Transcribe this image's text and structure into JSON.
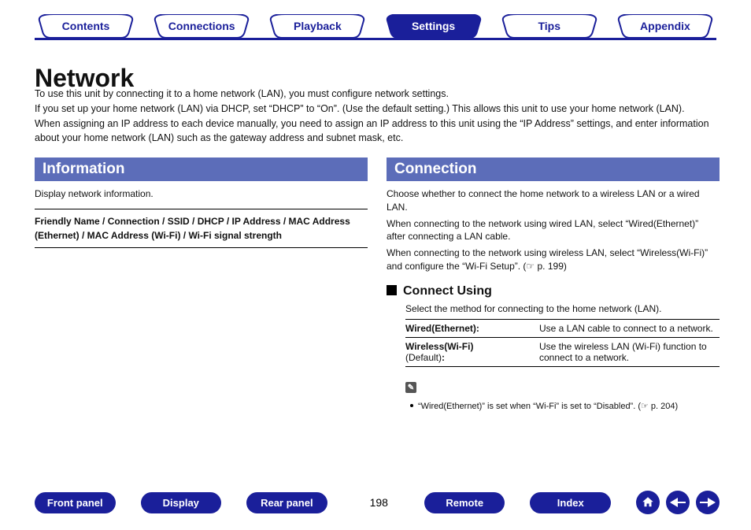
{
  "tabs": {
    "contents": "Contents",
    "connections": "Connections",
    "playback": "Playback",
    "settings": "Settings",
    "tips": "Tips",
    "appendix": "Appendix"
  },
  "heading": "Network",
  "intro": {
    "l1": "To use this unit by connecting it to a home network (LAN), you must configure network settings.",
    "l2": "If you set up your home network (LAN) via DHCP, set “DHCP” to “On”. (Use the default setting.) This allows this unit to use your home network (LAN).",
    "l3": "When assigning an IP address to each device manually, you need to assign an IP address to this unit using the “IP Address” settings, and enter information about your home network (LAN) such as the gateway address and subnet mask, etc."
  },
  "left": {
    "title": "Information",
    "desc": "Display network information.",
    "box": "Friendly Name / Connection / SSID / DHCP / IP Address / MAC Address (Ethernet) / MAC Address (Wi-Fi) / Wi-Fi signal strength"
  },
  "right": {
    "title": "Connection",
    "p1": "Choose whether to connect the home network to a wireless LAN or a wired LAN.",
    "p2": "When connecting to the network using wired LAN, select “Wired(Ethernet)” after connecting a LAN cable.",
    "p3a": "When connecting to the network using wireless LAN, select “Wireless(Wi-Fi)” and configure the “Wi-Fi Setup”. (",
    "p3ref": "☞ p. 199",
    "p3b": ")",
    "sub": "Connect Using",
    "subdesc": "Select the method for connecting to the home network (LAN).",
    "opt1k": "Wired(Ethernet):",
    "opt1v": "Use a LAN cable to connect to a network.",
    "opt2k": "Wireless(Wi-Fi)",
    "opt2default": "(Default)",
    "opt2colon": ":",
    "opt2v": "Use the wireless LAN (Wi-Fi) function to connect to a network.",
    "noteicon": "✎",
    "note_a": "“Wired(Ethernet)” is set when “Wi-Fi” is set to “Disabled”.  (",
    "note_ref": "☞ p. 204",
    "note_b": ")"
  },
  "bottom": {
    "front": "Front panel",
    "display": "Display",
    "rear": "Rear panel",
    "page": "198",
    "remote": "Remote",
    "index": "Index"
  }
}
